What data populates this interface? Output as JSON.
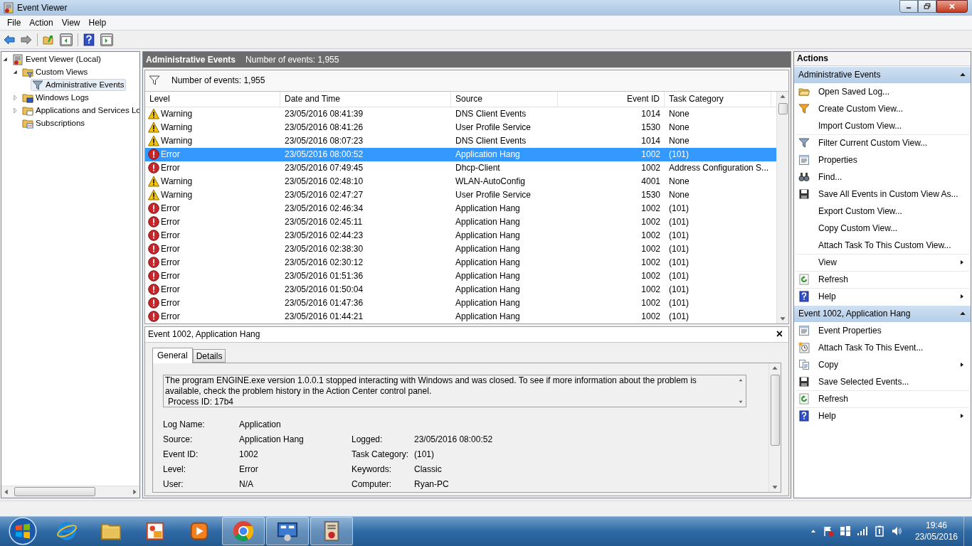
{
  "window": {
    "title": "Event Viewer"
  },
  "menu": [
    "File",
    "Action",
    "View",
    "Help"
  ],
  "tree": [
    {
      "label": "Event Viewer (Local)",
      "expanded": true,
      "selected": false,
      "children": [
        {
          "label": "Custom Views",
          "expanded": true,
          "selected": false,
          "children": [
            {
              "label": "Administrative Events",
              "selected": true
            }
          ]
        },
        {
          "label": "Windows Logs",
          "expanded": false,
          "selected": false
        },
        {
          "label": "Applications and Services Lo",
          "expanded": false,
          "selected": false
        },
        {
          "label": "Subscriptions",
          "selected": false
        }
      ]
    }
  ],
  "header": {
    "title": "Administrative Events",
    "count": "Number of events: 1,955"
  },
  "filter_text": "Number of events: 1,955",
  "columns": [
    "Level",
    "Date and Time",
    "Source",
    "Event ID",
    "Task Category"
  ],
  "rows": [
    {
      "kind": "warning",
      "level": "Warning",
      "date": "23/05/2016 08:41:39",
      "source": "DNS Client Events",
      "id": "1014",
      "task": "None",
      "selected": false
    },
    {
      "kind": "warning",
      "level": "Warning",
      "date": "23/05/2016 08:41:26",
      "source": "User Profile Service",
      "id": "1530",
      "task": "None",
      "selected": false
    },
    {
      "kind": "warning",
      "level": "Warning",
      "date": "23/05/2016 08:07:23",
      "source": "DNS Client Events",
      "id": "1014",
      "task": "None",
      "selected": false
    },
    {
      "kind": "error",
      "level": "Error",
      "date": "23/05/2016 08:00:52",
      "source": "Application Hang",
      "id": "1002",
      "task": "(101)",
      "selected": true
    },
    {
      "kind": "error",
      "level": "Error",
      "date": "23/05/2016 07:49:45",
      "source": "Dhcp-Client",
      "id": "1002",
      "task": "Address Configuration S...",
      "selected": false
    },
    {
      "kind": "warning",
      "level": "Warning",
      "date": "23/05/2016 02:48:10",
      "source": "WLAN-AutoConfig",
      "id": "4001",
      "task": "None",
      "selected": false
    },
    {
      "kind": "warning",
      "level": "Warning",
      "date": "23/05/2016 02:47:27",
      "source": "User Profile Service",
      "id": "1530",
      "task": "None",
      "selected": false
    },
    {
      "kind": "error",
      "level": "Error",
      "date": "23/05/2016 02:46:34",
      "source": "Application Hang",
      "id": "1002",
      "task": "(101)",
      "selected": false
    },
    {
      "kind": "error",
      "level": "Error",
      "date": "23/05/2016 02:45:11",
      "source": "Application Hang",
      "id": "1002",
      "task": "(101)",
      "selected": false
    },
    {
      "kind": "error",
      "level": "Error",
      "date": "23/05/2016 02:44:23",
      "source": "Application Hang",
      "id": "1002",
      "task": "(101)",
      "selected": false
    },
    {
      "kind": "error",
      "level": "Error",
      "date": "23/05/2016 02:38:30",
      "source": "Application Hang",
      "id": "1002",
      "task": "(101)",
      "selected": false
    },
    {
      "kind": "error",
      "level": "Error",
      "date": "23/05/2016 02:30:12",
      "source": "Application Hang",
      "id": "1002",
      "task": "(101)",
      "selected": false
    },
    {
      "kind": "error",
      "level": "Error",
      "date": "23/05/2016 01:51:36",
      "source": "Application Hang",
      "id": "1002",
      "task": "(101)",
      "selected": false
    },
    {
      "kind": "error",
      "level": "Error",
      "date": "23/05/2016 01:50:04",
      "source": "Application Hang",
      "id": "1002",
      "task": "(101)",
      "selected": false
    },
    {
      "kind": "error",
      "level": "Error",
      "date": "23/05/2016 01:47:36",
      "source": "Application Hang",
      "id": "1002",
      "task": "(101)",
      "selected": false
    },
    {
      "kind": "error",
      "level": "Error",
      "date": "23/05/2016 01:44:21",
      "source": "Application Hang",
      "id": "1002",
      "task": "(101)",
      "selected": false
    }
  ],
  "detail": {
    "title": "Event 1002, Application Hang",
    "close": "×",
    "tabs": [
      {
        "label": "General",
        "selected": true
      },
      {
        "label": "Details",
        "selected": false
      }
    ],
    "message": "The program ENGINE.exe version 1.0.0.1 stopped interacting with Windows and was closed. To see if more information about the problem is available, check the problem history in the Action Center control panel.",
    "process": "Process ID: 17b4",
    "left_fields": [
      {
        "label": "Log Name:",
        "value": "Application"
      },
      {
        "label": "Source:",
        "value": "Application Hang"
      },
      {
        "label": "Event ID:",
        "value": "1002"
      },
      {
        "label": "Level:",
        "value": "Error"
      },
      {
        "label": "User:",
        "value": "N/A"
      }
    ],
    "right_fields": [
      {
        "label": "Logged:",
        "value": "23/05/2016 08:00:52"
      },
      {
        "label": "Task Category:",
        "value": "(101)"
      },
      {
        "label": "Keywords:",
        "value": "Classic"
      },
      {
        "label": "Computer:",
        "value": "Ryan-PC"
      }
    ]
  },
  "actions": {
    "title": "Actions",
    "sections": [
      {
        "title": "Administrative Events",
        "items": [
          {
            "label": "Open Saved Log...",
            "submenu": false,
            "divider": false
          },
          {
            "label": "Create Custom View...",
            "submenu": false,
            "divider": false
          },
          {
            "label": "Import Custom View...",
            "submenu": false,
            "divider": false
          },
          {
            "label": "Filter Current Custom View...",
            "submenu": false,
            "divider": true
          },
          {
            "label": "Properties",
            "submenu": false,
            "divider": false
          },
          {
            "label": "Find...",
            "submenu": false,
            "divider": false
          },
          {
            "label": "Save All Events in Custom View As...",
            "submenu": false,
            "divider": false
          },
          {
            "label": "Export Custom View...",
            "submenu": false,
            "divider": false
          },
          {
            "label": "Copy Custom View...",
            "submenu": false,
            "divider": false
          },
          {
            "label": "Attach Task To This Custom View...",
            "submenu": false,
            "divider": false
          },
          {
            "label": "View",
            "submenu": true,
            "divider": true
          },
          {
            "label": "Refresh",
            "submenu": false,
            "divider": true
          },
          {
            "label": "Help",
            "submenu": true,
            "divider": true
          }
        ]
      },
      {
        "title": "Event 1002, Application Hang",
        "items": [
          {
            "label": "Event Properties",
            "submenu": false,
            "divider": false
          },
          {
            "label": "Attach Task To This Event...",
            "submenu": false,
            "divider": false
          },
          {
            "label": "Copy",
            "submenu": true,
            "divider": false
          },
          {
            "label": "Save Selected Events...",
            "submenu": false,
            "divider": false
          },
          {
            "label": "Refresh",
            "submenu": false,
            "divider": true
          },
          {
            "label": "Help",
            "submenu": true,
            "divider": true
          }
        ]
      }
    ]
  },
  "taskbar": {
    "apps": [
      {
        "kind": "ie",
        "running": false
      },
      {
        "kind": "explorer",
        "running": false
      },
      {
        "kind": "paint",
        "running": false
      },
      {
        "kind": "media",
        "running": false
      },
      {
        "kind": "chrome",
        "running": true
      },
      {
        "kind": "control",
        "running": true
      },
      {
        "kind": "eventviewer",
        "running": true
      }
    ],
    "time": "19:46",
    "date": "23/05/2016"
  }
}
